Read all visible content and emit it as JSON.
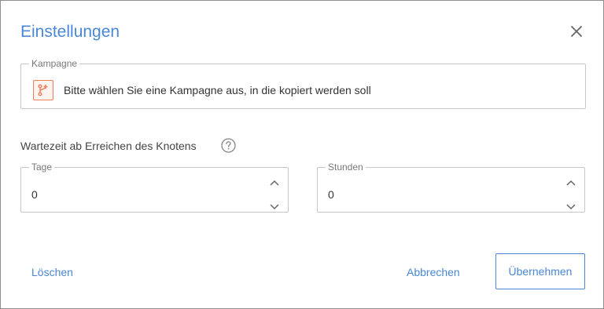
{
  "dialog": {
    "title": "Einstellungen",
    "close_icon": "close-icon"
  },
  "campaign": {
    "legend": "Kampagne",
    "icon": "campaign-branch-icon",
    "placeholder": "Bitte wählen Sie eine Kampagne aus, in die kopiert werden soll",
    "accent_color": "#ef7d5a"
  },
  "wait_time": {
    "label": "Wartezeit ab Erreichen des Knotens",
    "help_icon": "help-icon",
    "days": {
      "legend": "Tage",
      "value": "0"
    },
    "hours": {
      "legend": "Stunden",
      "value": "0"
    }
  },
  "footer": {
    "delete_label": "Löschen",
    "cancel_label": "Abbrechen",
    "apply_label": "Übernehmen"
  },
  "colors": {
    "accent": "#4a87d6",
    "border": "#c7c7c7",
    "text": "#333333"
  }
}
